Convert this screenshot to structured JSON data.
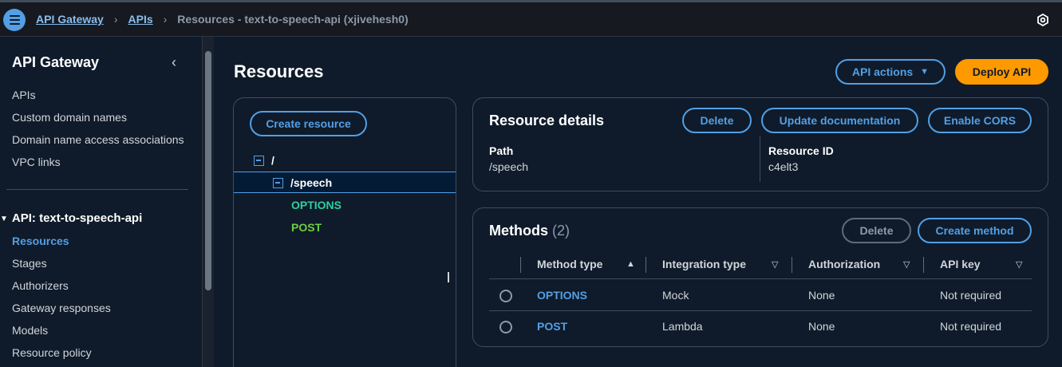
{
  "breadcrumb": {
    "items": [
      "API Gateway",
      "APIs"
    ],
    "current": "Resources - text-to-speech-api (xjivehesh0)"
  },
  "sidebar": {
    "title": "API Gateway",
    "top_items": [
      "APIs",
      "Custom domain names",
      "Domain name access associations",
      "VPC links"
    ],
    "section_title": "API: text-to-speech-api",
    "section_items": [
      "Resources",
      "Stages",
      "Authorizers",
      "Gateway responses",
      "Models",
      "Resource policy"
    ],
    "active_item": "Resources"
  },
  "page": {
    "title": "Resources",
    "api_actions_label": "API actions",
    "deploy_label": "Deploy API"
  },
  "tree": {
    "create_label": "Create resource",
    "root": "/",
    "child": "/speech",
    "methods": [
      "OPTIONS",
      "POST"
    ]
  },
  "details": {
    "title": "Resource details",
    "delete_label": "Delete",
    "update_doc_label": "Update documentation",
    "cors_label": "Enable CORS",
    "path_label": "Path",
    "path_value": "/speech",
    "id_label": "Resource ID",
    "id_value": "c4elt3"
  },
  "methods": {
    "title": "Methods",
    "count": "(2)",
    "delete_label": "Delete",
    "create_label": "Create method",
    "columns": [
      "Method type",
      "Integration type",
      "Authorization",
      "API key"
    ],
    "rows": [
      {
        "method": "OPTIONS",
        "integration": "Mock",
        "authorization": "None",
        "api_key": "Not required"
      },
      {
        "method": "POST",
        "integration": "Lambda",
        "authorization": "None",
        "api_key": "Not required"
      }
    ]
  },
  "colors": {
    "accent": "#539fe5",
    "deploy": "#ff9900",
    "options": "#2fcfa0",
    "post": "#6fcf3f"
  }
}
